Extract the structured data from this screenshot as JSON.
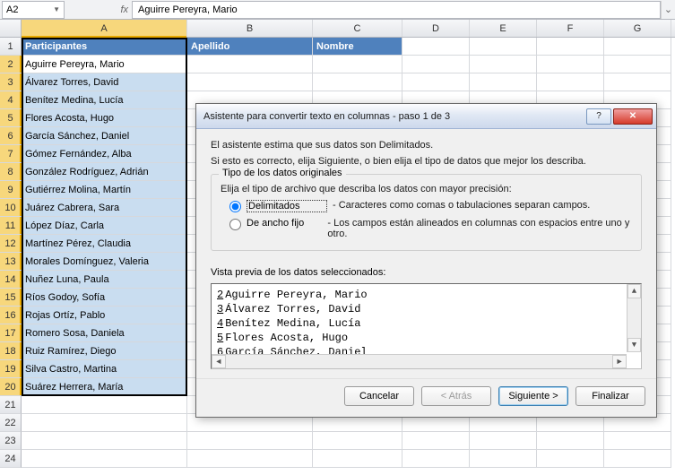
{
  "formula_bar": {
    "name_box_value": "A2",
    "fx_label": "fx",
    "formula_value": "Aguirre Pereyra, Mario"
  },
  "columns": [
    "A",
    "B",
    "C",
    "D",
    "E",
    "F",
    "G"
  ],
  "headers": {
    "A": "Participantes",
    "B": "Apellido",
    "C": "Nombre"
  },
  "data_rows": [
    "Aguirre Pereyra, Mario",
    "Álvarez Torres, David",
    "Benítez Medina, Lucía",
    "Flores Acosta, Hugo",
    "García Sánchez, Daniel",
    "Gómez Fernández, Alba",
    "González Rodríguez, Adrián",
    "Gutiérrez Molina, Martín",
    "Juárez Cabrera, Sara",
    "López Díaz, Carla",
    "Martínez Pérez, Claudia",
    "Morales Domínguez, Valeria",
    "Nuñez Luna, Paula",
    "Ríos Godoy, Sofía",
    "Rojas Ortíz, Pablo",
    "Romero Sosa, Daniela",
    "Ruiz Ramírez, Diego",
    "Silva Castro, Martina",
    "Suárez Herrera, María"
  ],
  "empty_rows_after": [
    21,
    22,
    23,
    24
  ],
  "dialog": {
    "title": "Asistente para convertir texto en columnas - paso 1 de 3",
    "line1": "El asistente estima que sus datos son Delimitados.",
    "line2": "Si esto es correcto, elija Siguiente, o bien elija el tipo de datos que mejor los describa.",
    "group_title": "Tipo de los datos originales",
    "group_instruction": "Elija el tipo de archivo que describa los datos con mayor precisión:",
    "radio1_label": "Delimitados",
    "radio1_desc": "- Caracteres como comas o tabulaciones separan campos.",
    "radio2_label": "De ancho fijo",
    "radio2_desc": "- Los campos están alineados en columnas con espacios entre uno y otro.",
    "preview_label": "Vista previa de los datos seleccionados:",
    "preview_rows": [
      {
        "num": "2",
        "text": "Aguirre Pereyra, Mario"
      },
      {
        "num": "3",
        "text": "Álvarez Torres, David"
      },
      {
        "num": "4",
        "text": "Benítez Medina, Lucía"
      },
      {
        "num": "5",
        "text": "Flores Acosta, Hugo"
      },
      {
        "num": "6",
        "text": "García Sánchez, Daniel"
      }
    ],
    "buttons": {
      "cancel": "Cancelar",
      "back": "< Atrás",
      "next": "Siguiente >",
      "finish": "Finalizar"
    },
    "help_symbol": "?",
    "close_symbol": "✕"
  }
}
